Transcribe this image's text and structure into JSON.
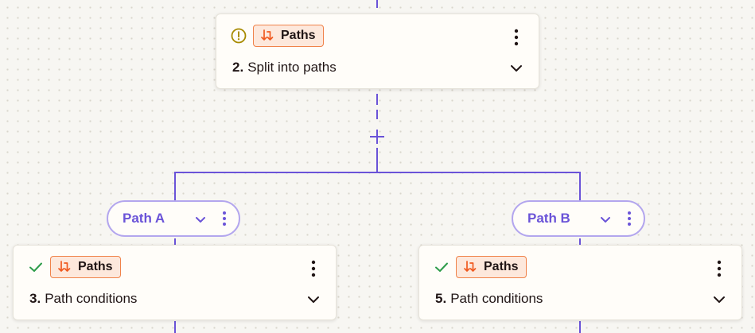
{
  "colors": {
    "accent": "#6a53d8",
    "pill_border": "#b3a6ee",
    "badge_bg": "#fde8dc",
    "badge_border": "#f0834a",
    "badge_icon": "#f0591f",
    "warning": "#a78a00",
    "success": "#2d9c4a",
    "canvas_bg": "#f7f6f2",
    "card_bg": "#fffdf9"
  },
  "steps": [
    {
      "app_label": "Paths",
      "app_icon": "paths-icon",
      "status_icon": "warning-icon",
      "number": "2.",
      "title": "Split into paths"
    },
    {
      "app_label": "Paths",
      "app_icon": "paths-icon",
      "status_icon": "check-icon",
      "number": "3.",
      "title": "Path conditions"
    },
    {
      "app_label": "Paths",
      "app_icon": "paths-icon",
      "status_icon": "check-icon",
      "number": "5.",
      "title": "Path conditions"
    }
  ],
  "paths": [
    {
      "label": "Path A"
    },
    {
      "label": "Path B"
    }
  ],
  "icons": {
    "add": "plus-icon",
    "menu": "more-vertical-icon",
    "expand": "chevron-down-icon"
  }
}
